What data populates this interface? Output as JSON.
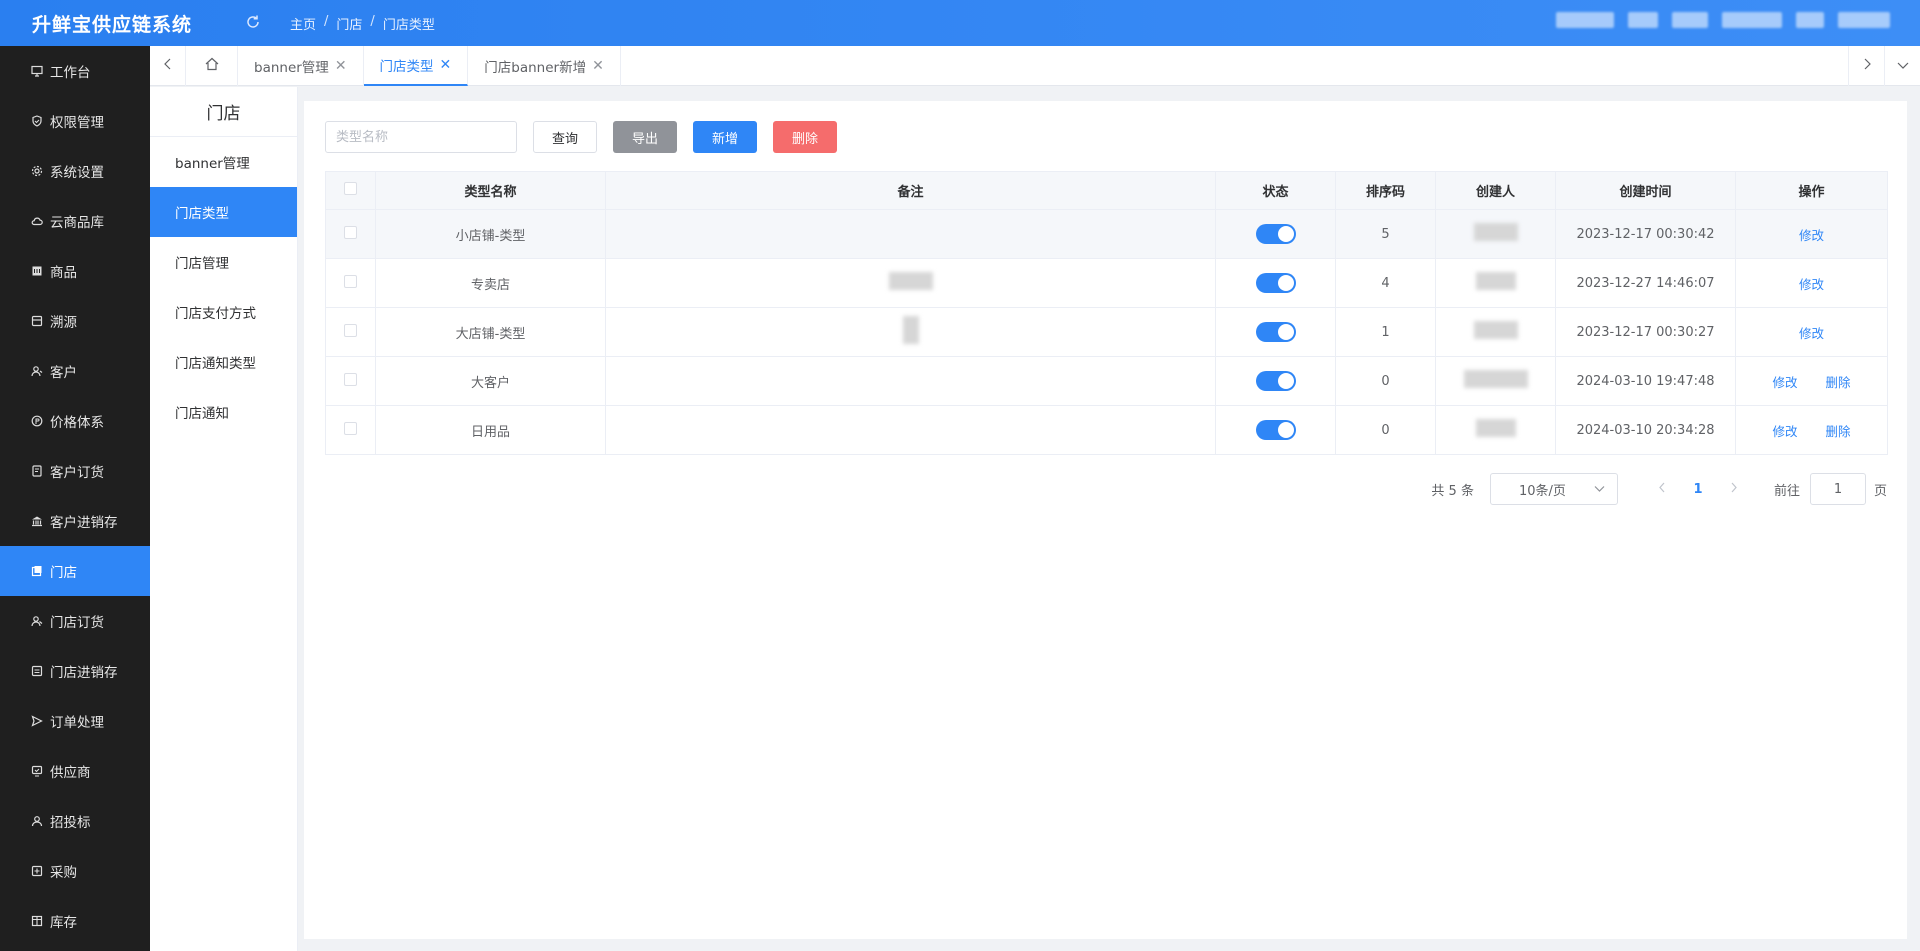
{
  "header": {
    "app_title": "升鲜宝供应链系统",
    "breadcrumb": [
      "主页",
      "门店",
      "门店类型"
    ],
    "breadcrumb_sep": "/"
  },
  "sidebar": {
    "items": [
      {
        "label": "工作台",
        "icon": "monitor-icon"
      },
      {
        "label": "权限管理",
        "icon": "shield-icon"
      },
      {
        "label": "系统设置",
        "icon": "gear-icon"
      },
      {
        "label": "云商品库",
        "icon": "cloud-icon"
      },
      {
        "label": "商品",
        "icon": "goods-icon"
      },
      {
        "label": "溯源",
        "icon": "trace-icon"
      },
      {
        "label": "客户",
        "icon": "customer-icon"
      },
      {
        "label": "价格体系",
        "icon": "price-icon"
      },
      {
        "label": "客户订货",
        "icon": "order-icon"
      },
      {
        "label": "客户进销存",
        "icon": "bank-icon"
      },
      {
        "label": "门店",
        "icon": "store-icon",
        "active": true
      },
      {
        "label": "门店订货",
        "icon": "store-order-icon"
      },
      {
        "label": "门店进销存",
        "icon": "store-stock-icon"
      },
      {
        "label": "订单处理",
        "icon": "send-icon"
      },
      {
        "label": "供应商",
        "icon": "supplier-icon"
      },
      {
        "label": "招投标",
        "icon": "bid-icon"
      },
      {
        "label": "采购",
        "icon": "purchase-icon"
      },
      {
        "label": "库存",
        "icon": "inventory-icon"
      }
    ]
  },
  "tabs": [
    {
      "label": "banner管理",
      "active": false
    },
    {
      "label": "门店类型",
      "active": true
    },
    {
      "label": "门店banner新增",
      "active": false
    }
  ],
  "submenu": {
    "title": "门店",
    "items": [
      {
        "label": "banner管理",
        "active": false
      },
      {
        "label": "门店类型",
        "active": true
      },
      {
        "label": "门店管理",
        "active": false
      },
      {
        "label": "门店支付方式",
        "active": false
      },
      {
        "label": "门店通知类型",
        "active": false
      },
      {
        "label": "门店通知",
        "active": false
      }
    ]
  },
  "toolbar": {
    "search_placeholder": "类型名称",
    "query_label": "查询",
    "export_label": "导出",
    "add_label": "新增",
    "delete_label": "删除"
  },
  "table": {
    "headers": [
      "类型名称",
      "备注",
      "状态",
      "排序码",
      "创建人",
      "创建时间",
      "操作"
    ],
    "rows": [
      {
        "name": "小店铺-类型",
        "sort": "5",
        "time": "2023-12-17 00:30:42",
        "status_on": true,
        "ops": [
          "修改"
        ]
      },
      {
        "name": "专卖店",
        "sort": "4",
        "time": "2023-12-27 14:46:07",
        "status_on": true,
        "ops": [
          "修改"
        ]
      },
      {
        "name": "大店铺-类型",
        "sort": "1",
        "time": "2023-12-17 00:30:27",
        "status_on": true,
        "ops": [
          "修改"
        ]
      },
      {
        "name": "大客户",
        "sort": "0",
        "time": "2024-03-10 19:47:48",
        "status_on": true,
        "ops": [
          "修改",
          "删除"
        ]
      },
      {
        "name": "日用品",
        "sort": "0",
        "time": "2024-03-10 20:34:28",
        "status_on": true,
        "ops": [
          "修改",
          "删除"
        ]
      }
    ]
  },
  "pagination": {
    "total": "共 5 条",
    "page_size": "10条/页",
    "current_page": "1",
    "goto_label": "前往",
    "goto_value": "1",
    "page_suffix": "页"
  },
  "colors": {
    "primary": "#2f86f6",
    "danger": "#f56c6c",
    "gray": "#909399",
    "sidebar_bg": "#1f1f1f"
  }
}
